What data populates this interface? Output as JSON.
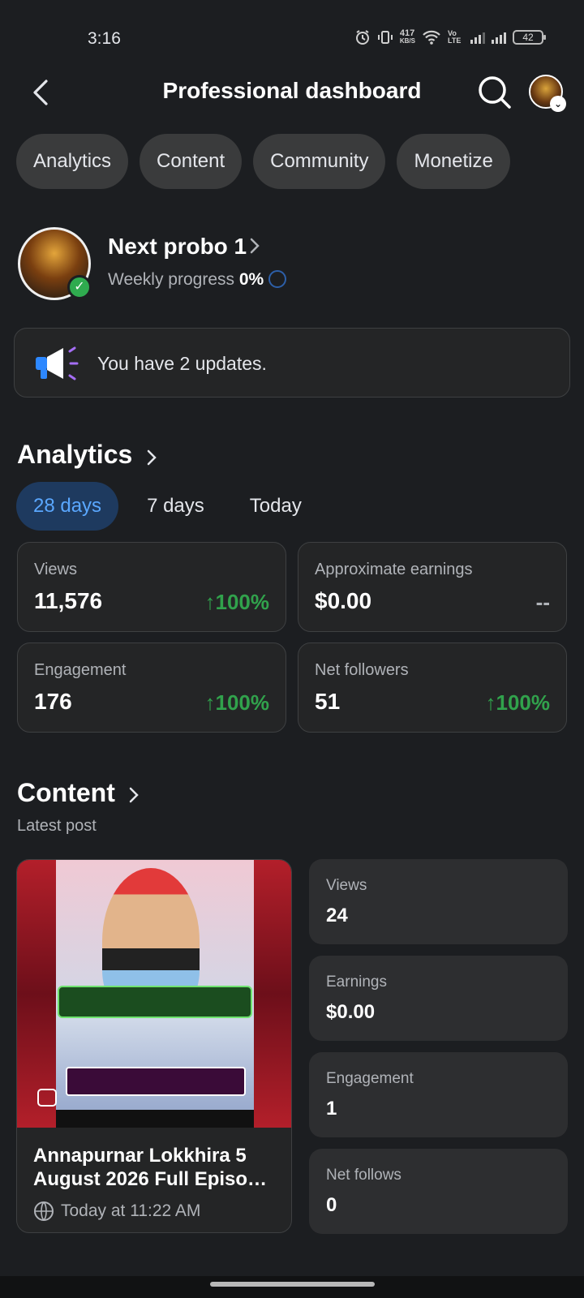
{
  "status": {
    "time": "3:16",
    "net_speed_value": "417",
    "net_speed_unit": "KB/S",
    "battery": "42",
    "volte_label": "Vo LTE"
  },
  "header": {
    "title": "Professional dashboard"
  },
  "chips": [
    "Analytics",
    "Content",
    "Community",
    "Monetize"
  ],
  "page": {
    "name": "Next probo 1",
    "weekly_label": "Weekly progress",
    "weekly_value": "0%"
  },
  "updates": {
    "text": "You have 2 updates."
  },
  "analytics": {
    "title": "Analytics",
    "ranges": [
      "28 days",
      "7 days",
      "Today"
    ],
    "selected_range": "28 days",
    "cards": [
      {
        "label": "Views",
        "value": "11,576",
        "change": "100%",
        "trend": "up"
      },
      {
        "label": "Approximate earnings",
        "value": "$0.00",
        "change": "--",
        "trend": "none"
      },
      {
        "label": "Engagement",
        "value": "176",
        "change": "100%",
        "trend": "up"
      },
      {
        "label": "Net followers",
        "value": "51",
        "change": "100%",
        "trend": "up"
      }
    ]
  },
  "content": {
    "title": "Content",
    "subtitle": "Latest post",
    "post": {
      "title": "Annapurnar Lokkhira 5 August 2026 Full Episo…",
      "time": "Today at 11:22 AM"
    },
    "stats": [
      {
        "label": "Views",
        "value": "24"
      },
      {
        "label": "Earnings",
        "value": "$0.00"
      },
      {
        "label": "Engagement",
        "value": "1"
      },
      {
        "label": "Net follows",
        "value": "0"
      }
    ]
  },
  "colors": {
    "background": "#1c1e21",
    "card": "#242526",
    "accent_blue": "#5aa7ff",
    "positive_green": "#31a24c",
    "verified_green": "#2fab4f"
  }
}
